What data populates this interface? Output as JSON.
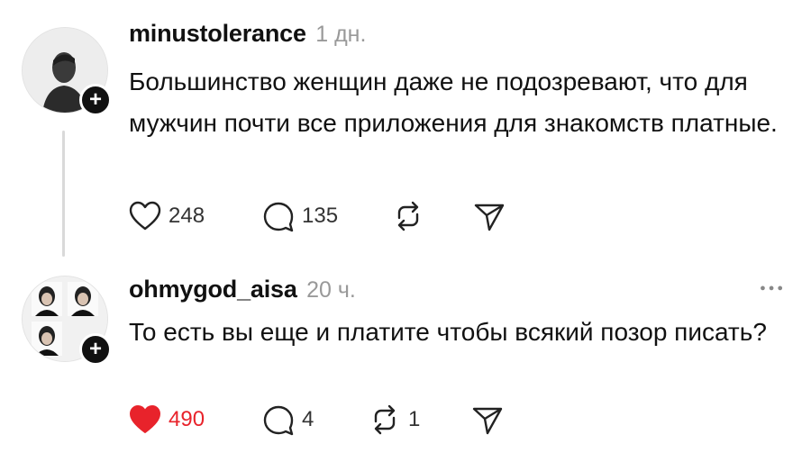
{
  "posts": [
    {
      "username": "minustolerance",
      "time": "1 дн.",
      "text": "Большинство женщин даже не подозревают, что для мужчин почти все приложения для знакомств платные.",
      "likes": "248",
      "replies": "135",
      "reposts": "",
      "liked": false
    },
    {
      "username": "ohmygod_aisa",
      "time": "20 ч.",
      "text": "То есть вы еще и платите чтобы всякий позор писать?",
      "likes": "490",
      "replies": "4",
      "reposts": "1",
      "liked": true
    }
  ],
  "icons": {
    "like": "heart-icon",
    "reply": "comment-icon",
    "repost": "repost-icon",
    "share": "send-icon",
    "follow": "plus-icon",
    "more": "more-dots-icon"
  },
  "colors": {
    "liked": "#e8232b",
    "muted": "#999999",
    "text": "#111111"
  }
}
